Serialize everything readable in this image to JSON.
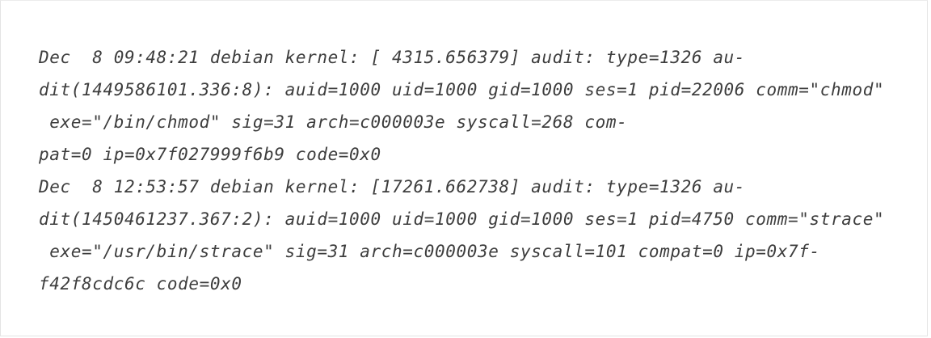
{
  "log": {
    "lines": [
      "Dec  8 09:48:21 debian kernel: [ 4315.656379] audit: type=1326 au-",
      "dit(1449586101.336:8): auid=1000 uid=1000 gid=1000 ses=1 pid=22006 comm=\"chmod\"",
      " exe=\"/bin/chmod\" sig=31 arch=c000003e syscall=268 com-",
      "pat=0 ip=0x7f027999f6b9 code=0x0",
      "Dec  8 12:53:57 debian kernel: [17261.662738] audit: type=1326 au-",
      "dit(1450461237.367:2): auid=1000 uid=1000 gid=1000 ses=1 pid=4750 comm=\"strace\"",
      " exe=\"/usr/bin/strace\" sig=31 arch=c000003e syscall=101 compat=0 ip=0x7f-",
      "f42f8cdc6c code=0x0"
    ]
  }
}
